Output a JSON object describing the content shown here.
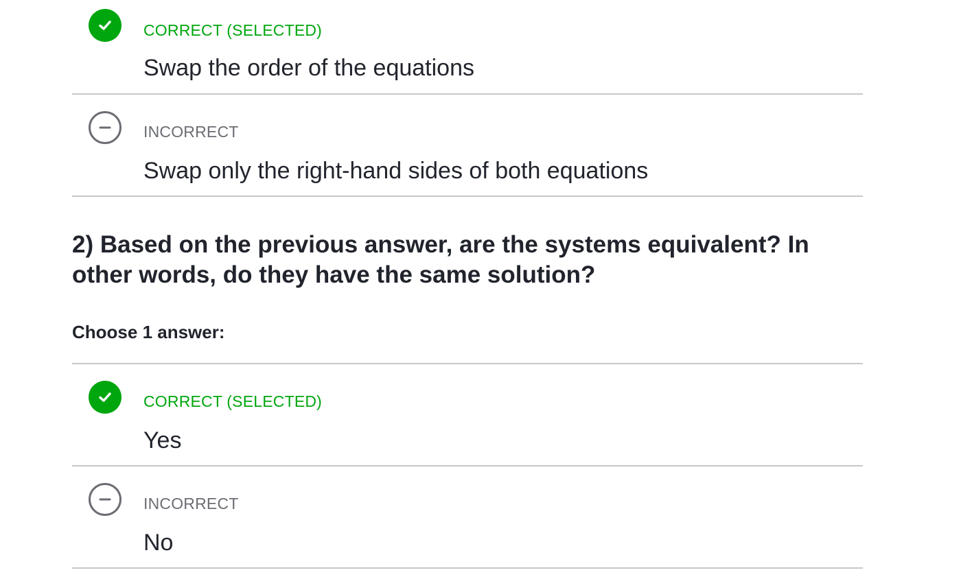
{
  "previous_question": {
    "choices": [
      {
        "status": "CORRECT (SELECTED)",
        "status_type": "correct",
        "text": "Swap the order of the equations",
        "icon": "checkmark-icon"
      },
      {
        "status": "INCORRECT",
        "status_type": "incorrect",
        "text": "Swap only the right-hand sides of both equations",
        "icon": "minus-circle-icon"
      }
    ]
  },
  "question2": {
    "prompt": "2) Based on the previous answer, are the systems equivalent? In other words, do they have the same solution?",
    "instruction": "Choose 1 answer:",
    "choices": [
      {
        "status": "CORRECT (SELECTED)",
        "status_type": "correct",
        "text": "Yes",
        "icon": "checkmark-icon"
      },
      {
        "status": "INCORRECT",
        "status_type": "incorrect",
        "text": "No",
        "icon": "minus-circle-icon"
      }
    ]
  },
  "colors": {
    "correct": "#00a60e",
    "incorrect": "#6b6d73",
    "divider": "#c6c8cc",
    "text": "#21242c"
  }
}
